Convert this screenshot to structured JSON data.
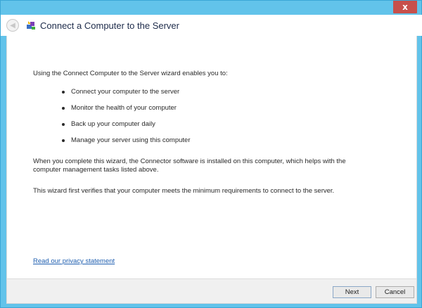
{
  "window": {
    "title": "Connect a Computer to the Server",
    "close_label": "x"
  },
  "content": {
    "intro": "Using the Connect Computer to the Server wizard enables you to:",
    "bullets": [
      "Connect your computer to the server",
      "Monitor the health of your computer",
      "Back up your computer daily",
      "Manage your server using this computer"
    ],
    "paragraph1": "When you complete this wizard, the Connector software is installed on this computer, which helps with the computer management tasks listed above.",
    "paragraph2": "This wizard first verifies that your computer meets the minimum requirements to connect to the server.",
    "privacy_link": "Read our privacy statement"
  },
  "footer": {
    "next_label": "Next",
    "cancel_label": "Cancel"
  },
  "icons": {
    "back": "back-arrow-icon",
    "app": "connector-app-icon",
    "close": "close-icon"
  },
  "colors": {
    "window_frame": "#62c3ea",
    "close_button": "#c7504b",
    "link": "#1f5fb0"
  }
}
